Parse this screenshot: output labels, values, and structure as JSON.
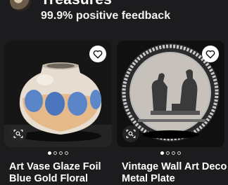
{
  "seller": {
    "name": "Treasures",
    "feedback": "99.9% positive feedback"
  },
  "listings": [
    {
      "title": "Art Vase Glaze Foil Blue Gold Floral",
      "image_icon": "vase-photo",
      "page_indicator": {
        "count": 4,
        "active": 1
      }
    },
    {
      "title": "Vintage Wall Art Deco Metal Plate",
      "image_icon": "plate-photo",
      "page_indicator": {
        "count": 4,
        "active": 1
      }
    }
  ],
  "icons": {
    "favorite": "heart-icon",
    "visual_search": "image-search-icon"
  }
}
